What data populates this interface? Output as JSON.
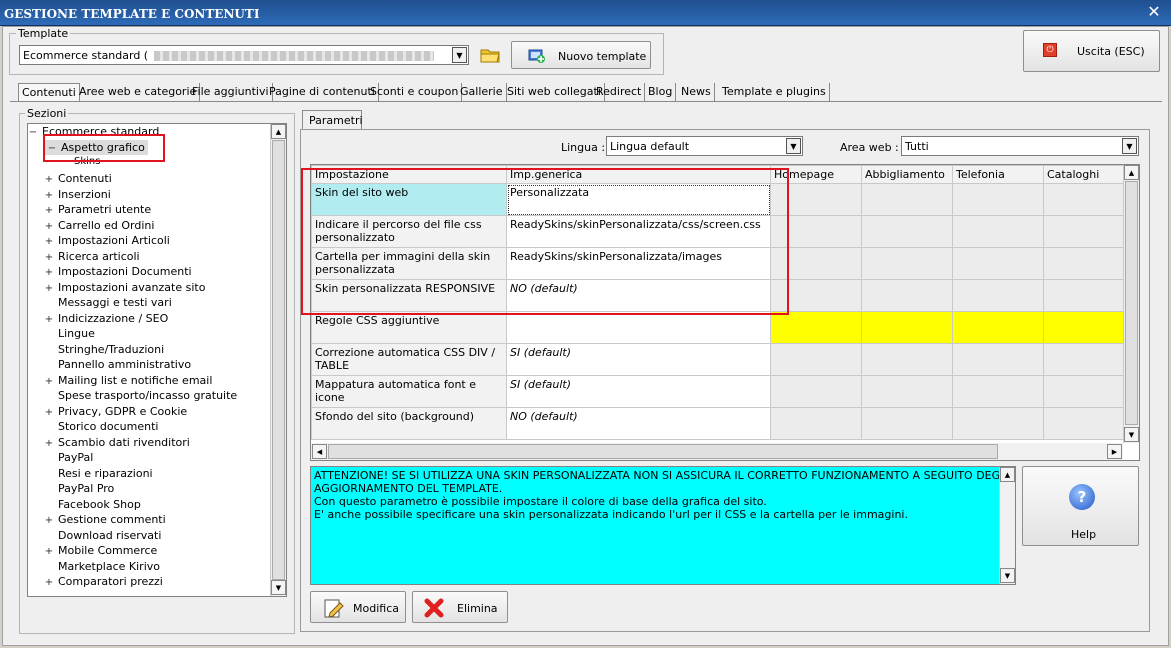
{
  "window": {
    "title": "GESTIONE TEMPLATE E CONTENUTI"
  },
  "template": {
    "legend": "Template",
    "combo_value": "Ecommerce standard (",
    "new_button": "Nuovo template"
  },
  "exit_button": "Uscita (ESC)",
  "tabs": [
    "Contenuti",
    "Aree web e categorie",
    "File aggiuntivi",
    "Pagine di contenuti",
    "Sconti e coupon",
    "Gallerie",
    "Siti web collegati",
    "Redirect",
    "Blog",
    "News",
    "Template e plugins"
  ],
  "sections": {
    "legend": "Sezioni",
    "root": "Ecommerce standard",
    "selected": "Aspetto grafico",
    "child": "Skins",
    "items": [
      {
        "label": "Contenuti",
        "expandable": true
      },
      {
        "label": "Inserzioni",
        "expandable": true
      },
      {
        "label": "Parametri utente",
        "expandable": true
      },
      {
        "label": "Carrello ed Ordini",
        "expandable": true
      },
      {
        "label": "Impostazioni Articoli",
        "expandable": true
      },
      {
        "label": "Ricerca articoli",
        "expandable": true
      },
      {
        "label": "Impostazioni Documenti",
        "expandable": true
      },
      {
        "label": "Impostazioni avanzate sito",
        "expandable": true
      },
      {
        "label": "Messaggi e testi vari",
        "expandable": false
      },
      {
        "label": "Indicizzazione / SEO",
        "expandable": true
      },
      {
        "label": "Lingue",
        "expandable": false
      },
      {
        "label": "Stringhe/Traduzioni",
        "expandable": false
      },
      {
        "label": "Pannello amministrativo",
        "expandable": false
      },
      {
        "label": "Mailing list e notifiche email",
        "expandable": true
      },
      {
        "label": "Spese trasporto/incasso gratuite",
        "expandable": false
      },
      {
        "label": "Privacy, GDPR e Cookie",
        "expandable": true
      },
      {
        "label": "Storico documenti",
        "expandable": false
      },
      {
        "label": "Scambio dati rivenditori",
        "expandable": true
      },
      {
        "label": "PayPal",
        "expandable": false
      },
      {
        "label": "Resi e riparazioni",
        "expandable": false
      },
      {
        "label": "PayPal Pro",
        "expandable": false
      },
      {
        "label": "Facebook Shop",
        "expandable": false
      },
      {
        "label": "Gestione commenti",
        "expandable": true
      },
      {
        "label": "Download riservati",
        "expandable": false
      },
      {
        "label": "Mobile Commerce",
        "expandable": true
      },
      {
        "label": "Marketplace Kirivo",
        "expandable": false
      },
      {
        "label": "Comparatori prezzi",
        "expandable": true
      }
    ]
  },
  "params": {
    "tab": "Parametri",
    "lingua_label": "Lingua :",
    "lingua_value": "Lingua default",
    "area_label": "Area web :",
    "area_value": "Tutti",
    "headers": [
      "Impostazione",
      "Imp.generica",
      "Homepage",
      "Abbigliamento",
      "Telefonia",
      "Cataloghi"
    ],
    "rows": [
      {
        "name": "Skin del sito web",
        "value": "Personalizzata",
        "italic": false
      },
      {
        "name": "Indicare il percorso del file css personalizzato",
        "value": "ReadySkins/skinPersonalizzata/css/screen.css",
        "italic": false
      },
      {
        "name": "Cartella per immagini della skin personalizzata",
        "value": "ReadySkins/skinPersonalizzata/images",
        "italic": false
      },
      {
        "name": "Skin personalizzata RESPONSIVE",
        "value": "NO (default)",
        "italic": true
      },
      {
        "name": "Regole CSS aggiuntive",
        "value": "",
        "italic": false
      },
      {
        "name": "Correzione automatica CSS DIV / TABLE",
        "value": "SI (default)",
        "italic": true
      },
      {
        "name": "Mappatura automatica font e icone",
        "value": "SI (default)",
        "italic": true
      },
      {
        "name": "Sfondo del sito (background)",
        "value": "NO (default)",
        "italic": true
      }
    ]
  },
  "info": {
    "line1": "ATTENZIONE! SE SI UTILIZZA UNA SKIN PERSONALIZZATA NON SI ASSICURA IL CORRETTO FUNZIONAMENTO A SEGUITO DEGLI",
    "line2": "AGGIORNAMENTO DEL TEMPLATE.",
    "line3": "Con questo parametro è possibile impostare il colore di base della grafica del sito.",
    "line4": "E' anche possibile specificare una skin personalizzata indicando l'url per il CSS e la cartella per le immagini."
  },
  "help_label": "Help",
  "modifica_label": "Modifica",
  "elimina_label": "Elimina",
  "colors": {
    "selected_cell": "#b0ecf0",
    "highlight_yellow": "#ffff00",
    "info_bg": "#00ffff",
    "annotation_red": "#e0141e"
  }
}
